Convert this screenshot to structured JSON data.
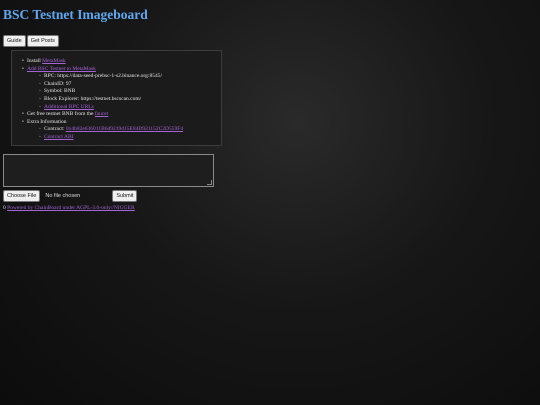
{
  "header": {
    "title": "BSC Testnet Imageboard"
  },
  "toolbar": {
    "guide_label": "Guide",
    "get_posts_label": "Get Posts"
  },
  "info": {
    "install_prefix": "Install ",
    "metamask_link": "MetaMask",
    "add_network_link": "Add BSC Testnet to MetaMask",
    "rpc": "RPC: https://data-seed-prebsc-1-s2.binance.org:8545/",
    "chain_id": "ChainID: 97",
    "symbol": "Symbol: BNB",
    "explorer": "Block Explorer: https://testnet.bscscan.com/",
    "additional_rpc_link": "Additional RPC URLs",
    "faucet_prefix": "Get free testnet BNB from the ",
    "faucet_link": "faucet",
    "extra_info": "Extra Information",
    "contract_prefix": "Contract: ",
    "contract_address": "0x4b82e636011B6d9219d15E84D921152C2D559F4",
    "contract_abi_link": "Contract ABI"
  },
  "post_form": {
    "textarea_value": "",
    "choose_file_label": "Choose File",
    "no_file_text": "No file chosen",
    "submit_label": "Submit"
  },
  "footer": {
    "count": "0",
    "powered_link": "Powered by ChainBoard under AGPL-3.0-only//NIGGER"
  }
}
